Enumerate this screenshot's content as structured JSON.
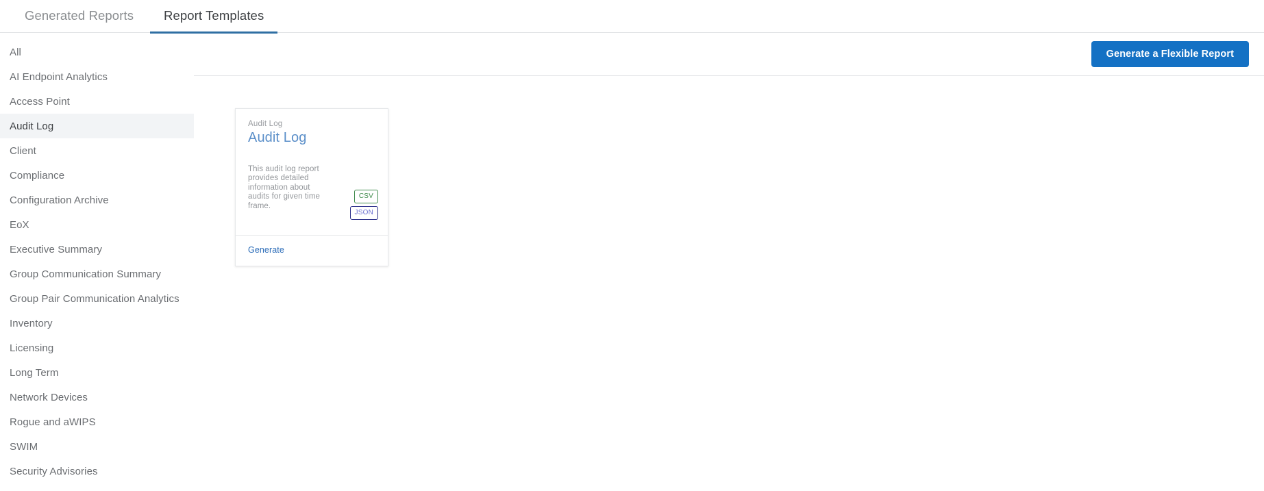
{
  "tabs": [
    {
      "label": "Generated Reports",
      "active": false
    },
    {
      "label": "Report Templates",
      "active": true
    }
  ],
  "sidebar": {
    "items": [
      {
        "label": "All",
        "selected": false
      },
      {
        "label": "AI Endpoint Analytics",
        "selected": false
      },
      {
        "label": "Access Point",
        "selected": false
      },
      {
        "label": "Audit Log",
        "selected": true
      },
      {
        "label": "Client",
        "selected": false
      },
      {
        "label": "Compliance",
        "selected": false
      },
      {
        "label": "Configuration Archive",
        "selected": false
      },
      {
        "label": "EoX",
        "selected": false
      },
      {
        "label": "Executive Summary",
        "selected": false
      },
      {
        "label": "Group Communication Summary",
        "selected": false
      },
      {
        "label": "Group Pair Communication Analytics",
        "selected": false
      },
      {
        "label": "Inventory",
        "selected": false
      },
      {
        "label": "Licensing",
        "selected": false
      },
      {
        "label": "Long Term",
        "selected": false
      },
      {
        "label": "Network Devices",
        "selected": false
      },
      {
        "label": "Rogue and aWIPS",
        "selected": false
      },
      {
        "label": "SWIM",
        "selected": false
      },
      {
        "label": "Security Advisories",
        "selected": false
      }
    ]
  },
  "toolbar": {
    "flexible_report_label": "Generate a Flexible Report"
  },
  "cards": [
    {
      "category": "Audit Log",
      "title": "Audit Log",
      "description": "This audit log report provides detailed information about audits for given time frame.",
      "formats": [
        "CSV",
        "JSON"
      ],
      "generate_label": "Generate"
    }
  ],
  "colors": {
    "accent_button": "#1471c4",
    "tab_underline": "#2f6fa3",
    "card_title": "#5b8fc9",
    "link": "#2b6cb8",
    "csv_badge": "#3f8a4b",
    "json_badge": "#2b2f8a",
    "selected_row": "#f2f4f6"
  }
}
